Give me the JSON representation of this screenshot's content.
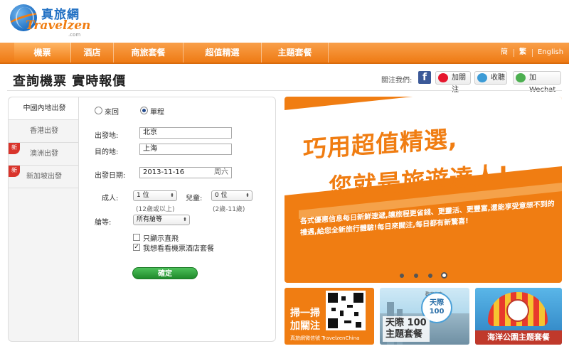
{
  "logo": {
    "cn": "真旅網",
    "en": "Travelzen",
    "com": ".com"
  },
  "nav": {
    "items": [
      "機票",
      "酒店",
      "商旅套餐",
      "超值精選",
      "主題套餐"
    ],
    "lang": [
      "簡",
      "繁",
      "English"
    ]
  },
  "page_title": "查詢機票  實時報價",
  "follow": {
    "label": "關注我們:",
    "facebook": "f",
    "weibo": "加關注",
    "renren": "收聽",
    "wechat": "加 Wechat"
  },
  "tabs": [
    {
      "label": "中國內地出發",
      "new": false
    },
    {
      "label": "香港出發",
      "new": false
    },
    {
      "label": "澳洲出發",
      "new": true
    },
    {
      "label": "新加坡出發",
      "new": true
    }
  ],
  "new_badge": "新",
  "form": {
    "round_trip": "來回",
    "one_way": "單程",
    "from_label": "出發地:",
    "from_value": "北京",
    "to_label": "目的地:",
    "to_value": "上海",
    "date_label": "出發日期:",
    "date_value": "2013-11-16",
    "date_dow": "周六",
    "adult_label": "成人:",
    "adult_value": "1 位",
    "adult_hint": "(12歲或以上)",
    "child_label": "兒童:",
    "child_value": "0 位",
    "child_hint": "(2歲-11歲)",
    "cabin_label": "艙等:",
    "cabin_value": "所有艙等",
    "direct_only": "只顯示直飛",
    "package": "我想看看機票酒店套餐",
    "confirm": "確定"
  },
  "banner": {
    "headline1": "巧用超值精選,",
    "headline2": "您就是旅遊達人!",
    "body": "各式優惠信息每日新鮮速遞,讓旅程更省錢、更靈活、更豐富,還能享受意想不到的禮遇,給您全新旅行體驗!每日來關注,每日都有新驚喜!"
  },
  "promos": {
    "wechat_line1": "掃一掃",
    "wechat_line2": "加關注",
    "wechat_caption": "真旅網微信號 TravelzenChina",
    "tianji_badge_top": "歡迎光臨",
    "tianji_badge": "天際100",
    "tianji_line1": "天際 100",
    "tianji_line2": "主題套餐",
    "ocean_label": "海洋公園主題套餐"
  }
}
